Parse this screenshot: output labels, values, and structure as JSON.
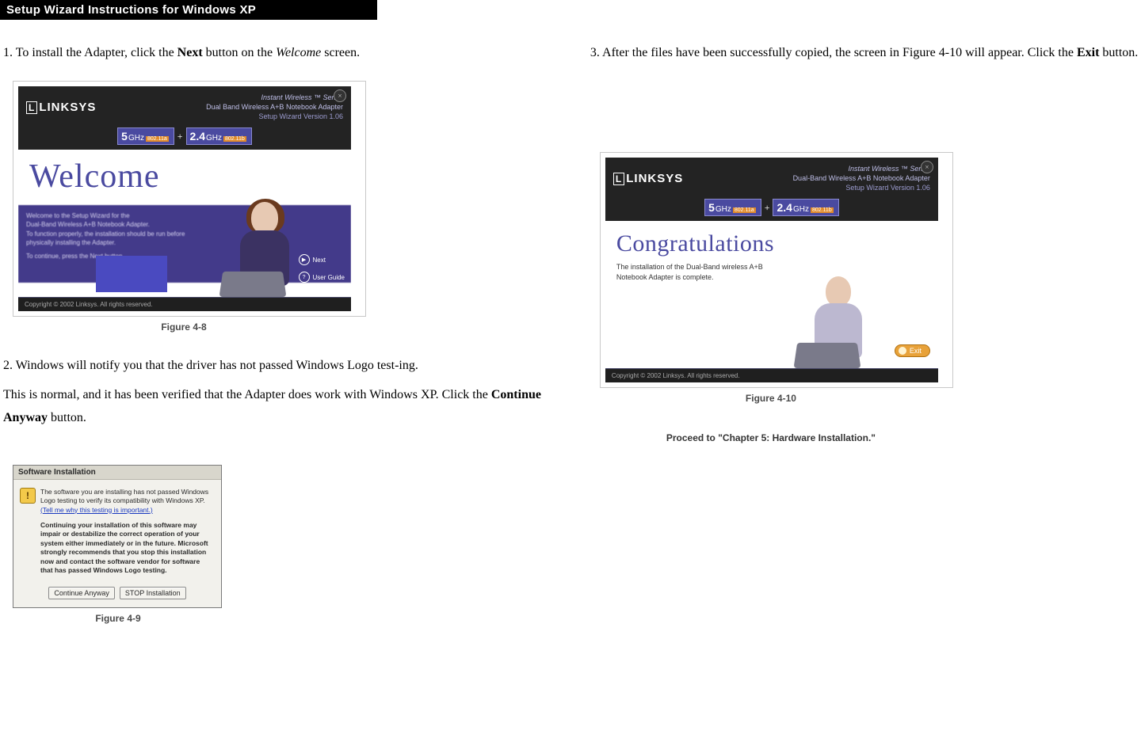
{
  "title_bar": "Setup Wizard Instructions for Windows XP",
  "left": {
    "step1": {
      "prefix": "1. To install the Adapter, click the ",
      "bold1": "Next",
      "mid1": " button on the ",
      "italic1": "Welcome",
      "suffix": " screen."
    },
    "step2a": "2. Windows will notify you that the driver has not passed Windows Logo test-ing.",
    "step2b": {
      "prefix": "This is normal, and it has been verified that the Adapter does work with Windows XP. Click the ",
      "bold1": "Continue Anyway",
      "suffix": " button."
    }
  },
  "right": {
    "step3": {
      "prefix": "3. After the files have been successfully copied, the screen in Figure 4-10 will appear. Click the ",
      "bold1": "Exit",
      "suffix": " button."
    },
    "proceed": "Proceed to \"Chapter 5: Hardware Installation.\""
  },
  "fig48": {
    "caption": "Figure 4-8",
    "logo": "LINKSYS",
    "top_line1": "Instant Wireless ™ Series",
    "top_line2": "Dual Band Wireless A+B Notebook Adapter",
    "top_line3": "Setup Wizard Version 1.06",
    "band_5": "5",
    "band_5_unit": "GHz",
    "band_5_tag": "802.11a",
    "band_plus": "+",
    "band_24": "2.4",
    "band_24_unit": "GHz",
    "band_24_tag": "802.11b",
    "welcome": "Welcome",
    "purple_l1": "Welcome to the Setup Wizard for the",
    "purple_l2": "Dual-Band Wireless A+B Notebook Adapter.",
    "purple_l3": "To function properly, the installation should be run before",
    "purple_l4": "physically installing the Adapter.",
    "purple_l5": "To continue, press the Next button.",
    "btn_next": "Next",
    "btn_guide": "User Guide",
    "footer": "Copyright © 2002 Linksys. All rights reserved."
  },
  "fig49": {
    "caption": "Figure 4-9",
    "title": "Software Installation",
    "body_l1": "The software you are installing has not passed Windows Logo testing to verify its compatibility with Windows XP.",
    "body_link": "(Tell me why this testing is important.)",
    "body_bold": "Continuing your installation of this software may impair or destabilize the correct operation of your system either immediately or in the future. Microsoft strongly recommends that you stop this installation now and contact the software vendor for software that has passed Windows Logo testing.",
    "btn_continue": "Continue Anyway",
    "btn_stop": "STOP Installation"
  },
  "fig410": {
    "caption": "Figure 4-10",
    "logo": "LINKSYS",
    "top_line1": "Instant Wireless ™ Series",
    "top_line2": "Dual-Band Wireless A+B Notebook Adapter",
    "top_line3": "Setup Wizard Version 1.06",
    "title": "Congratulations",
    "sub_l1": "The installation of the Dual-Band wireless A+B",
    "sub_l2": "Notebook Adapter is complete.",
    "btn_exit": "Exit",
    "footer": "Copyright © 2002 Linksys. All rights reserved."
  }
}
